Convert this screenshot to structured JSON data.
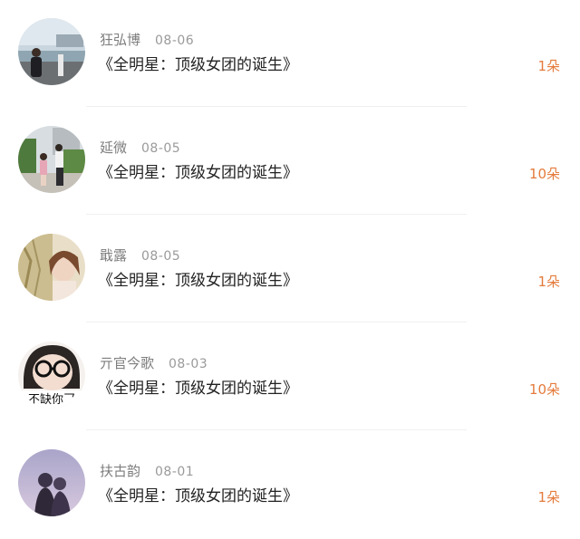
{
  "items": [
    {
      "user": "狂弘博",
      "date": "08-06",
      "title": "《全明星：顶级女团的诞生》",
      "count": "1朵",
      "avatar": "avatar-photo-riverside"
    },
    {
      "user": "延微",
      "date": "08-05",
      "title": "《全明星：顶级女团的诞生》",
      "count": "10朵",
      "avatar": "avatar-photo-street"
    },
    {
      "user": "戢露",
      "date": "08-05",
      "title": "《全明星：顶级女团的诞生》",
      "count": "1朵",
      "avatar": "avatar-photo-portrait"
    },
    {
      "user": "亓官今歌",
      "date": "08-03",
      "title": "《全明星：顶级女团的诞生》",
      "count": "10朵",
      "avatar": "avatar-photo-glasses",
      "avatar_text": "不缺你乛"
    },
    {
      "user": "扶古韵",
      "date": "08-01",
      "title": "《全明星：顶级女团的诞生》",
      "count": "1朵",
      "avatar": "avatar-photo-couple"
    }
  ],
  "colors": {
    "accent": "#e47b3c",
    "name": "#7d7d7d",
    "date": "#9a9a9a",
    "title": "#222222",
    "divider": "#f0f0f0"
  }
}
